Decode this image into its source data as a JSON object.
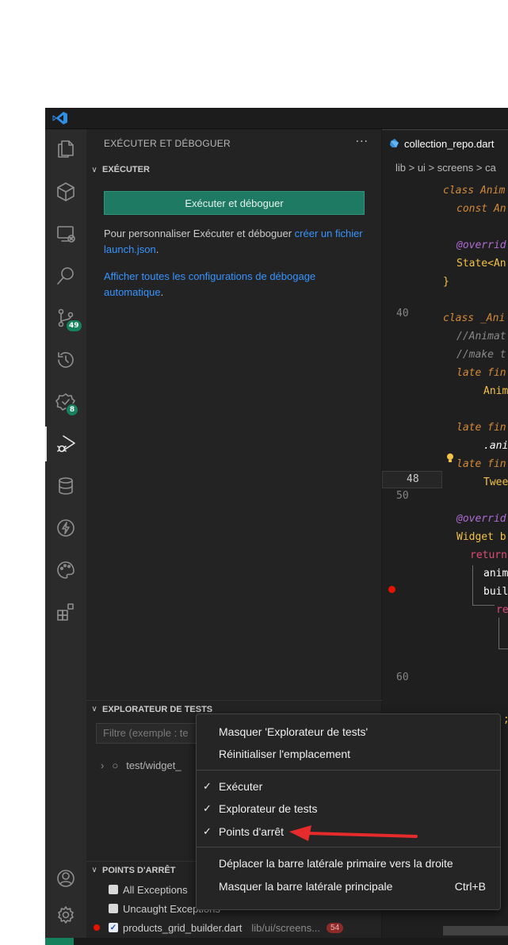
{
  "sidebar": {
    "title": "EXÉCUTER ET DÉBOGUER",
    "more": "···",
    "run_section": {
      "header": "EXÉCUTER",
      "button": "Exécuter et déboguer",
      "text1_prefix": "Pour personnaliser Exécuter et déboguer ",
      "text1_link": "créer un fichier launch.json",
      "text1_suffix": ".",
      "link2": "Afficher toutes les configurations de débogage automatique",
      "link2_suffix": "."
    },
    "tests_section": {
      "header": "EXPLORATEUR DE TESTS",
      "filter_placeholder": "Filtre (exemple : te",
      "item": "test/widget_"
    },
    "breakpoints_section": {
      "header": "POINTS D'ARRÊT",
      "items": [
        {
          "label": "All Exceptions",
          "checked": false
        },
        {
          "label": "Uncaught Exceptions",
          "checked": false
        },
        {
          "label": "products_grid_builder.dart",
          "checked": true,
          "path": "lib/ui/screens...",
          "count": "54"
        }
      ]
    }
  },
  "activity": {
    "scm_badge": "49",
    "testing_badge": "8"
  },
  "editor": {
    "tab": "collection_repo.dart",
    "breadcrumb": "lib > ui > screens > ca",
    "line_numbers": [
      "40",
      "48",
      "50",
      "60"
    ],
    "code": [
      "class Anim",
      "const An",
      "@overrid",
      "State<An",
      "}",
      "class _Ani",
      "//Animat",
      "//make t",
      "late fin",
      "Anim",
      "late fin",
      ".ani",
      "late fin",
      "Twee",
      "@overrid",
      "Widget b",
      "return",
      "anim",
      "buil",
      "re",
      ");"
    ]
  },
  "context_menu": {
    "items": [
      {
        "label": "Masquer 'Explorateur de tests'",
        "check": ""
      },
      {
        "label": "Réinitialiser l'emplacement",
        "check": ""
      },
      {
        "label": "Exécuter",
        "check": "✓"
      },
      {
        "label": "Explorateur de tests",
        "check": "✓"
      },
      {
        "label": "Points d'arrêt",
        "check": "✓"
      },
      {
        "label": "Déplacer la barre latérale primaire vers la droite",
        "check": ""
      },
      {
        "label": "Masquer la barre latérale principale",
        "check": "",
        "shortcut": "Ctrl+B"
      }
    ]
  },
  "colors": {
    "accent_button": "#1f7a64",
    "badge": "#16825d",
    "link": "#3794ff",
    "breakpoint": "#e51400",
    "arrow": "#e52b2b"
  }
}
